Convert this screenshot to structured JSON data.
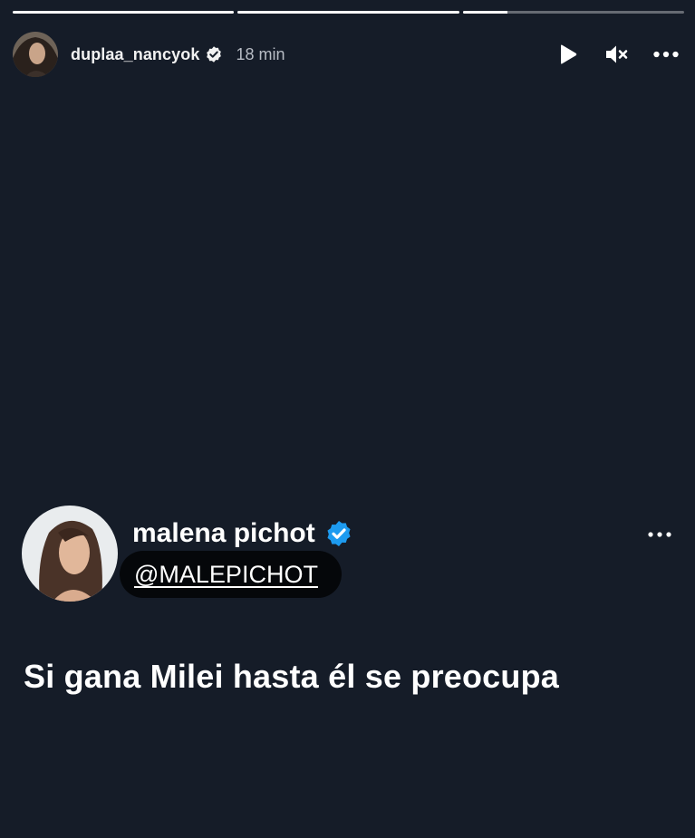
{
  "story": {
    "progress": [
      1.0,
      1.0,
      0.2
    ],
    "header": {
      "username": "duplaa_nancyok",
      "time": "18 min",
      "icons": {
        "verified": "verified-badge-icon",
        "play": "play-icon",
        "mute": "muted-speaker-icon",
        "more": "more-horizontal-icon"
      }
    }
  },
  "tweet": {
    "name": "malena pichot",
    "handle": "@MALEPICHOT",
    "text": "Si gana Milei hasta él se preocupa",
    "icons": {
      "verified": "verified-badge-icon",
      "more": "more-horizontal-icon"
    }
  },
  "colors": {
    "background": "#151c28",
    "verified_blue": "#1d9bf0",
    "handle_pill": "#05070a"
  }
}
